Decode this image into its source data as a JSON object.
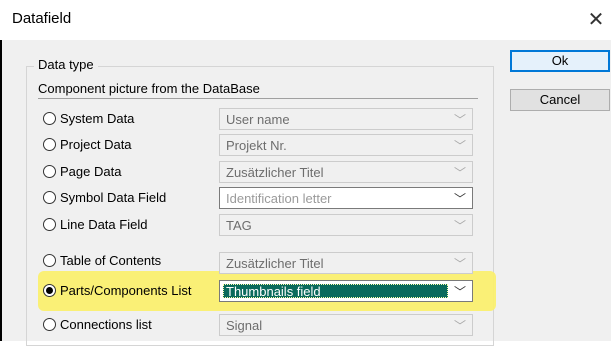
{
  "window": {
    "title": "Datafield"
  },
  "group": {
    "label": "Data type",
    "section_label": "Component picture from the DataBase"
  },
  "rows": [
    {
      "label": "System Data",
      "value": "User name",
      "checked": false,
      "state": "disabled"
    },
    {
      "label": "Project Data",
      "value": "Projekt Nr.",
      "checked": false,
      "state": "disabled"
    },
    {
      "label": "Page Data",
      "value": "Zusätzlicher Titel",
      "checked": false,
      "state": "disabled"
    },
    {
      "label": "Symbol Data Field",
      "value": "Identification letter",
      "checked": false,
      "state": "enabled"
    },
    {
      "label": "Line Data Field",
      "value": "TAG",
      "checked": false,
      "state": "disabled"
    },
    {
      "label": "Table of Contents",
      "value": "Zusätzlicher Titel",
      "checked": false,
      "state": "disabled"
    },
    {
      "label": "Parts/Components List",
      "value": "Thumbnails field",
      "checked": true,
      "state": "selected"
    },
    {
      "label": "Connections list",
      "value": "Signal",
      "checked": false,
      "state": "disabled"
    }
  ],
  "buttons": {
    "ok": "Ok",
    "cancel": "Cancel"
  },
  "colors": {
    "highlight": "#fbf06b",
    "selection": "#0a6a5c",
    "default_button_border": "#0078d7"
  },
  "icons": {
    "close": "close-icon",
    "dropdown": "chevron-down-icon"
  }
}
